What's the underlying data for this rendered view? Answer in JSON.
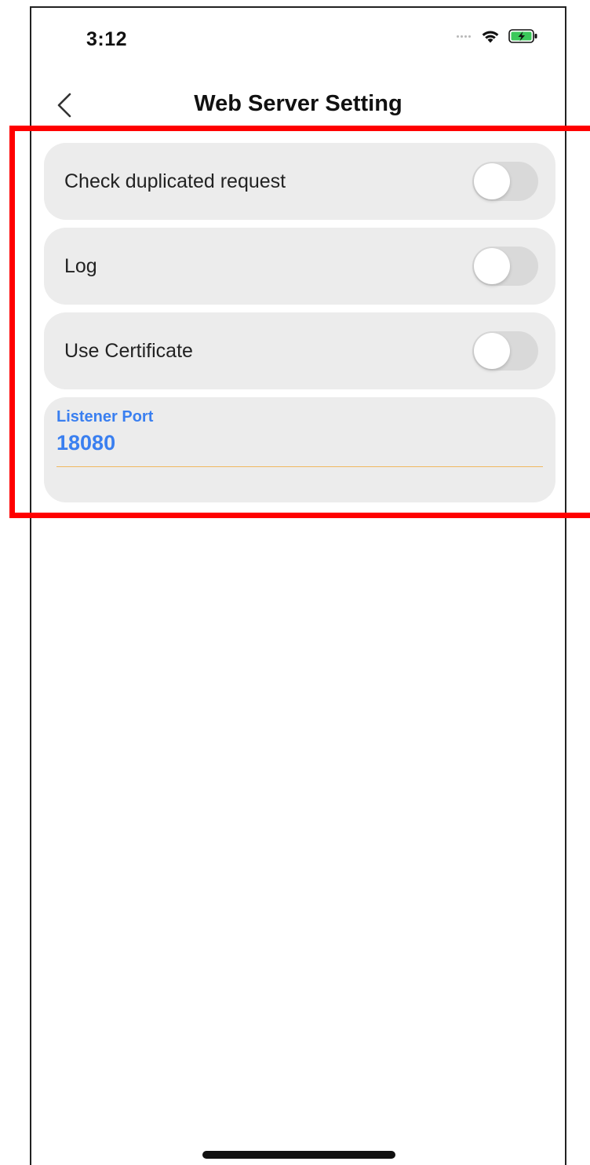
{
  "status_bar": {
    "time": "3:12",
    "icons": [
      "signal-dots-icon",
      "wifi-icon",
      "battery-charging-icon"
    ]
  },
  "nav": {
    "title": "Web Server Setting",
    "back_icon": "chevron-left-icon"
  },
  "settings": {
    "toggles": [
      {
        "label": "Check duplicated request",
        "enabled": false
      },
      {
        "label": "Log",
        "enabled": false
      },
      {
        "label": "Use Certificate",
        "enabled": false
      }
    ],
    "listener_port": {
      "label": "Listener Port",
      "value": "18080"
    }
  },
  "colors": {
    "accent": "#3a7ff0",
    "card_background": "#ececec",
    "highlight": "#ff0000",
    "input_underline": "#f0b860"
  }
}
